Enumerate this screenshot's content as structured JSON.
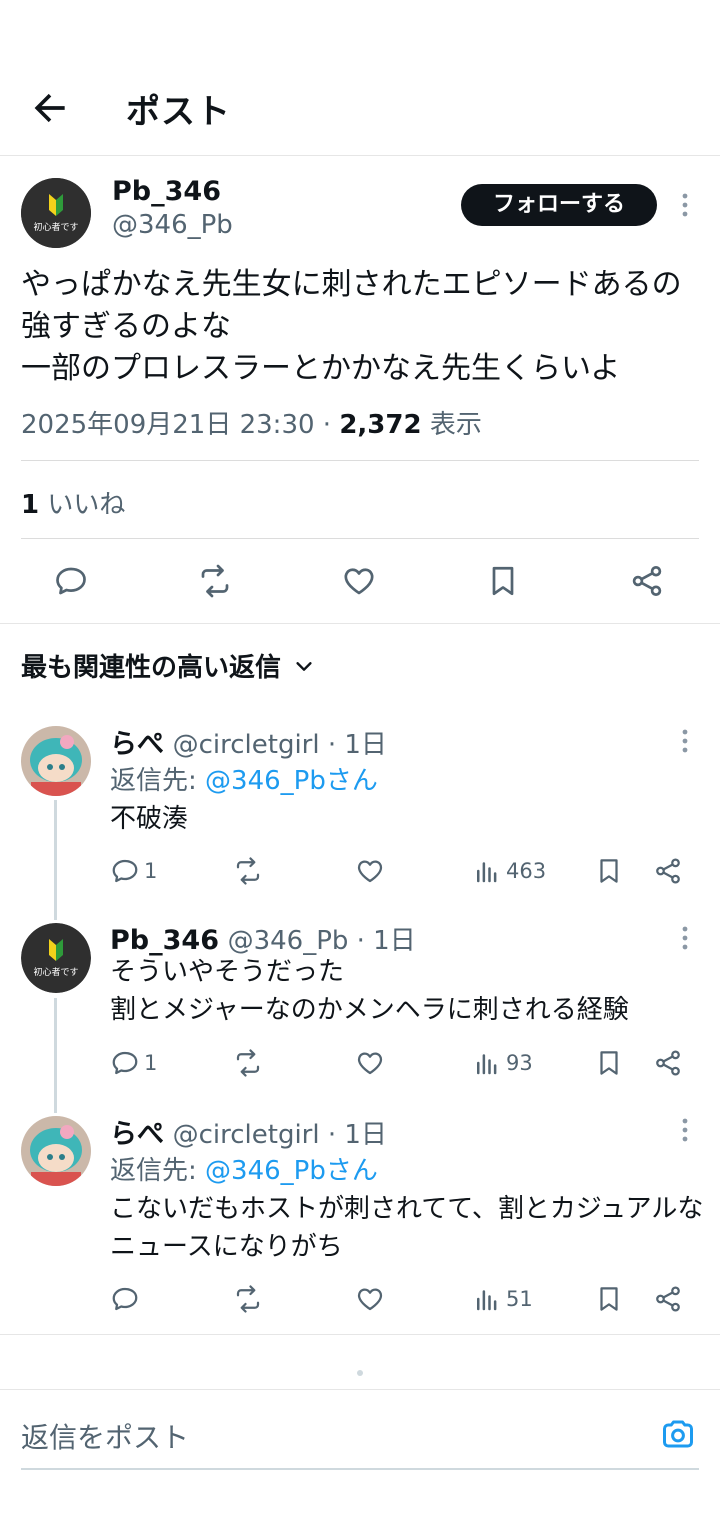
{
  "header": {
    "title": "ポスト",
    "back_icon": "arrow-left-icon"
  },
  "post": {
    "author_name": "Pb_346",
    "author_handle": "@346_Pb",
    "follow_label": "フォローする",
    "text": "やっぱかなえ先生女に刺されたエピソードあるの強すぎるのよな\n一部のプロレスラーとかかなえ先生くらいよ",
    "timestamp": "2025年09月21日 23:30",
    "meta_sep": " · ",
    "views": "2,372",
    "views_label": " 表示",
    "likes_count": "1",
    "likes_label": " いいね",
    "avatar_text": "初心者です"
  },
  "sort": {
    "label": "最も関連性の高い返信"
  },
  "replies": [
    {
      "name": "らぺ",
      "handle": "@circletgirl · 1日",
      "reply_to_label": "返信先: ",
      "reply_to_mention": "@346_Pbさん",
      "text": "不破湊",
      "replies": "1",
      "views": "463"
    },
    {
      "name": "Pb_346",
      "handle": "@346_Pb · 1日",
      "text": "そういやそうだった\n割とメジャーなのかメンヘラに刺される経験",
      "replies": "1",
      "views": "93"
    },
    {
      "name": "らぺ",
      "handle": "@circletgirl · 1日",
      "reply_to_label": "返信先: ",
      "reply_to_mention": "@346_Pbさん",
      "text": "こないだもホストが刺されてて、割とカジュアルなニュースになりがち",
      "views": "51"
    }
  ],
  "composer": {
    "placeholder": "返信をポスト",
    "camera_icon": "camera-icon"
  },
  "colors": {
    "accent": "#1d9bf0",
    "text": "#0f1419",
    "muted": "#536471",
    "divider": "#e6e6e6"
  }
}
